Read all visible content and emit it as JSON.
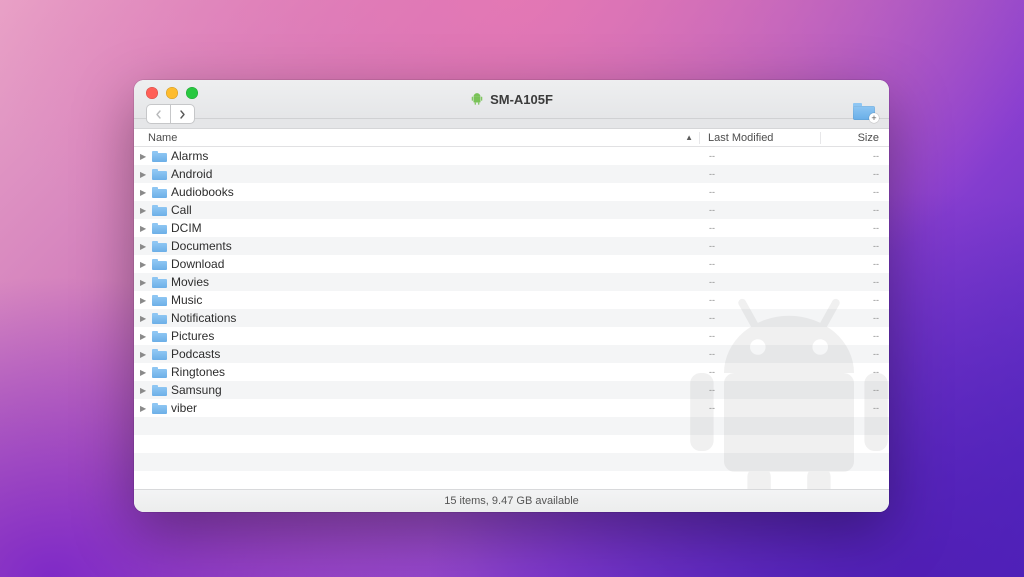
{
  "window": {
    "title": "SM-A105F"
  },
  "columns": {
    "name": "Name",
    "modified": "Last Modified",
    "size": "Size",
    "sort": "name-asc"
  },
  "items": [
    {
      "name": "Alarms",
      "modified": "--",
      "size": "--"
    },
    {
      "name": "Android",
      "modified": "--",
      "size": "--"
    },
    {
      "name": "Audiobooks",
      "modified": "--",
      "size": "--"
    },
    {
      "name": "Call",
      "modified": "--",
      "size": "--"
    },
    {
      "name": "DCIM",
      "modified": "--",
      "size": "--"
    },
    {
      "name": "Documents",
      "modified": "--",
      "size": "--"
    },
    {
      "name": "Download",
      "modified": "--",
      "size": "--"
    },
    {
      "name": "Movies",
      "modified": "--",
      "size": "--"
    },
    {
      "name": "Music",
      "modified": "--",
      "size": "--"
    },
    {
      "name": "Notifications",
      "modified": "--",
      "size": "--"
    },
    {
      "name": "Pictures",
      "modified": "--",
      "size": "--"
    },
    {
      "name": "Podcasts",
      "modified": "--",
      "size": "--"
    },
    {
      "name": "Ringtones",
      "modified": "--",
      "size": "--"
    },
    {
      "name": "Samsung",
      "modified": "--",
      "size": "--"
    },
    {
      "name": "viber",
      "modified": "--",
      "size": "--"
    }
  ],
  "status": "15 items, 9.47 GB available",
  "blank_rows": 5
}
